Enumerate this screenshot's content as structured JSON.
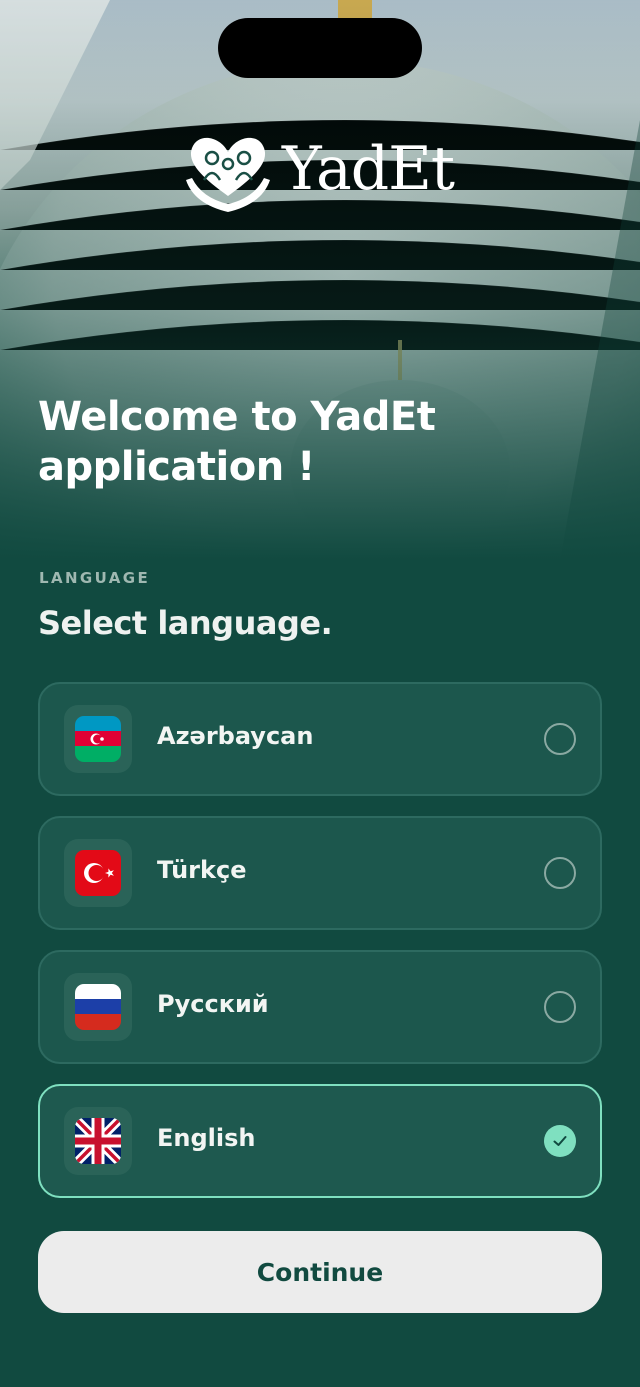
{
  "brand": {
    "name": "YadEt",
    "logo_icon": "heart-hands-family-icon"
  },
  "welcome": {
    "title": "Welcome to YadEt application !"
  },
  "language": {
    "section_label": "LANGUAGE",
    "title": "Select language.",
    "options": [
      {
        "label": "Azərbaycan",
        "flag_icon": "azerbaijan-flag-icon",
        "selected": false
      },
      {
        "label": "Türkçe",
        "flag_icon": "turkey-flag-icon",
        "selected": false
      },
      {
        "label": "Русский",
        "flag_icon": "russia-flag-icon",
        "selected": false
      },
      {
        "label": "English",
        "flag_icon": "uk-flag-icon",
        "selected": true
      }
    ]
  },
  "actions": {
    "continue_label": "Continue"
  },
  "colors": {
    "background": "#114a40",
    "card": "#1c574d",
    "accent": "#7fe0c0",
    "button": "#ececec",
    "button_text": "#114a40"
  }
}
